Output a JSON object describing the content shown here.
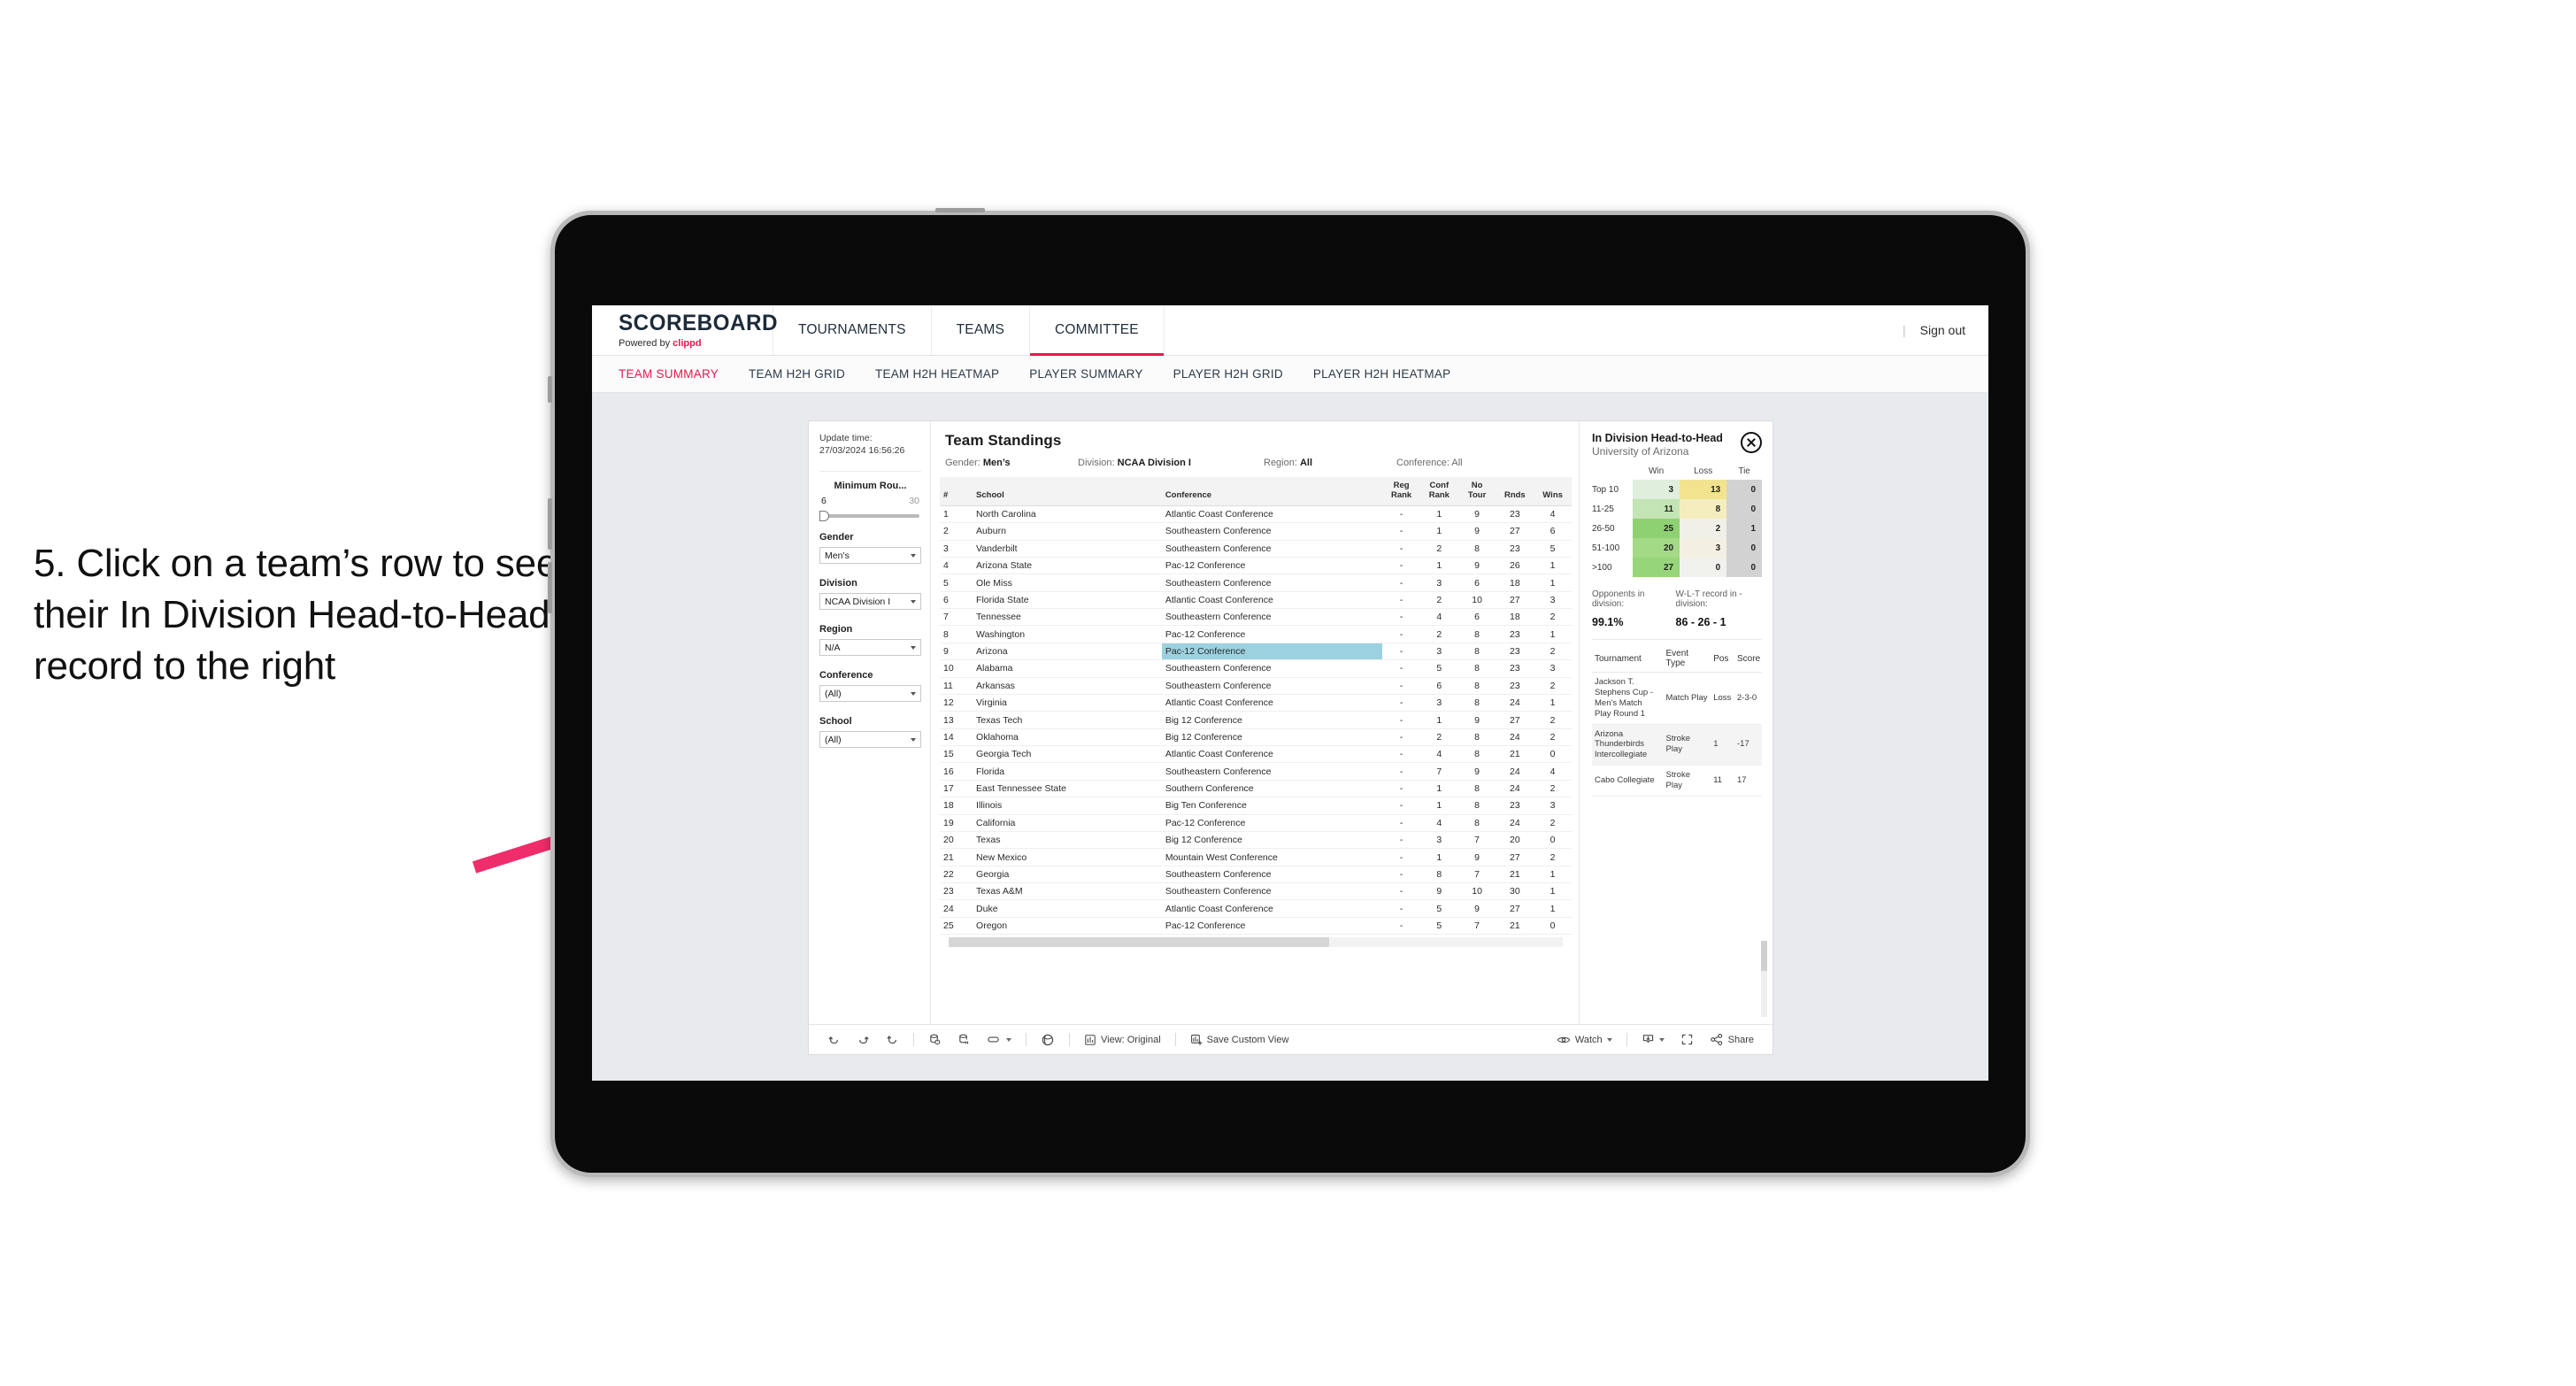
{
  "annotation": {
    "text": "5. Click on a team’s row to see their In Division Head-to-Head record to the right",
    "arrow_color": "#ef2d6b"
  },
  "brand": {
    "title": "SCOREBOARD",
    "powered_prefix": "Powered by ",
    "powered_name": "clippd",
    "accent": "#e8174c"
  },
  "topnav": {
    "items": [
      {
        "label": "TOURNAMENTS",
        "active": false
      },
      {
        "label": "TEAMS",
        "active": false
      },
      {
        "label": "COMMITTEE",
        "active": true
      }
    ],
    "separator": "|",
    "sign_out": "Sign out"
  },
  "subnav": {
    "tabs": [
      {
        "label": "TEAM SUMMARY",
        "active": true
      },
      {
        "label": "TEAM H2H GRID",
        "active": false
      },
      {
        "label": "TEAM H2H HEATMAP",
        "active": false
      },
      {
        "label": "PLAYER SUMMARY",
        "active": false
      },
      {
        "label": "PLAYER H2H GRID",
        "active": false
      },
      {
        "label": "PLAYER H2H HEATMAP",
        "active": false
      }
    ]
  },
  "filters": {
    "update_label": "Update time:",
    "update_value": "27/03/2024 16:56:26",
    "slider": {
      "label": "Minimum Rou...",
      "min": "6",
      "max": "30"
    },
    "gender": {
      "label": "Gender",
      "value": "Men’s"
    },
    "division": {
      "label": "Division",
      "value": "NCAA Division I"
    },
    "region": {
      "label": "Region",
      "value": "N/A"
    },
    "conference": {
      "label": "Conference",
      "value": "(All)"
    },
    "school": {
      "label": "School",
      "value": "(All)"
    }
  },
  "viz": {
    "title": "Team Standings",
    "meta": {
      "gender_label": "Gender: ",
      "gender_value": "Men’s",
      "division_label": "Division: ",
      "division_value": "NCAA Division I",
      "region_label": "Region: ",
      "region_value": "All",
      "conference_label": "Conference: ",
      "conference_value": "All"
    }
  },
  "standings": {
    "columns": [
      "#",
      "School",
      "Conference",
      "Reg Rank",
      "Conf Rank",
      "No Tour",
      "Rnds",
      "Wins"
    ],
    "columns_wrapped": [
      {
        "l1": "#",
        "l2": ""
      },
      {
        "l1": "School",
        "l2": ""
      },
      {
        "l1": "Conference",
        "l2": ""
      },
      {
        "l1": "Reg",
        "l2": "Rank"
      },
      {
        "l1": "Conf",
        "l2": "Rank"
      },
      {
        "l1": "No",
        "l2": "Tour"
      },
      {
        "l1": "Rnds",
        "l2": ""
      },
      {
        "l1": "Wins",
        "l2": ""
      }
    ],
    "selected_rank": 9,
    "selected_highlight_color": "#9cd2e0",
    "rows": [
      {
        "rank": "1",
        "school": "North Carolina",
        "conference": "Atlantic Coast Conference",
        "reg_rank": "-",
        "conf_rank": "1",
        "no_tour": "9",
        "rnds": "23",
        "wins": "4"
      },
      {
        "rank": "2",
        "school": "Auburn",
        "conference": "Southeastern Conference",
        "reg_rank": "-",
        "conf_rank": "1",
        "no_tour": "9",
        "rnds": "27",
        "wins": "6"
      },
      {
        "rank": "3",
        "school": "Vanderbilt",
        "conference": "Southeastern Conference",
        "reg_rank": "-",
        "conf_rank": "2",
        "no_tour": "8",
        "rnds": "23",
        "wins": "5"
      },
      {
        "rank": "4",
        "school": "Arizona State",
        "conference": "Pac-12 Conference",
        "reg_rank": "-",
        "conf_rank": "1",
        "no_tour": "9",
        "rnds": "26",
        "wins": "1"
      },
      {
        "rank": "5",
        "school": "Ole Miss",
        "conference": "Southeastern Conference",
        "reg_rank": "-",
        "conf_rank": "3",
        "no_tour": "6",
        "rnds": "18",
        "wins": "1"
      },
      {
        "rank": "6",
        "school": "Florida State",
        "conference": "Atlantic Coast Conference",
        "reg_rank": "-",
        "conf_rank": "2",
        "no_tour": "10",
        "rnds": "27",
        "wins": "3"
      },
      {
        "rank": "7",
        "school": "Tennessee",
        "conference": "Southeastern Conference",
        "reg_rank": "-",
        "conf_rank": "4",
        "no_tour": "6",
        "rnds": "18",
        "wins": "2"
      },
      {
        "rank": "8",
        "school": "Washington",
        "conference": "Pac-12 Conference",
        "reg_rank": "-",
        "conf_rank": "2",
        "no_tour": "8",
        "rnds": "23",
        "wins": "1"
      },
      {
        "rank": "9",
        "school": "Arizona",
        "conference": "Pac-12 Conference",
        "reg_rank": "-",
        "conf_rank": "3",
        "no_tour": "8",
        "rnds": "23",
        "wins": "2"
      },
      {
        "rank": "10",
        "school": "Alabama",
        "conference": "Southeastern Conference",
        "reg_rank": "-",
        "conf_rank": "5",
        "no_tour": "8",
        "rnds": "23",
        "wins": "3"
      },
      {
        "rank": "11",
        "school": "Arkansas",
        "conference": "Southeastern Conference",
        "reg_rank": "-",
        "conf_rank": "6",
        "no_tour": "8",
        "rnds": "23",
        "wins": "2"
      },
      {
        "rank": "12",
        "school": "Virginia",
        "conference": "Atlantic Coast Conference",
        "reg_rank": "-",
        "conf_rank": "3",
        "no_tour": "8",
        "rnds": "24",
        "wins": "1"
      },
      {
        "rank": "13",
        "school": "Texas Tech",
        "conference": "Big 12 Conference",
        "reg_rank": "-",
        "conf_rank": "1",
        "no_tour": "9",
        "rnds": "27",
        "wins": "2"
      },
      {
        "rank": "14",
        "school": "Oklahoma",
        "conference": "Big 12 Conference",
        "reg_rank": "-",
        "conf_rank": "2",
        "no_tour": "8",
        "rnds": "24",
        "wins": "2"
      },
      {
        "rank": "15",
        "school": "Georgia Tech",
        "conference": "Atlantic Coast Conference",
        "reg_rank": "-",
        "conf_rank": "4",
        "no_tour": "8",
        "rnds": "21",
        "wins": "0"
      },
      {
        "rank": "16",
        "school": "Florida",
        "conference": "Southeastern Conference",
        "reg_rank": "-",
        "conf_rank": "7",
        "no_tour": "9",
        "rnds": "24",
        "wins": "4"
      },
      {
        "rank": "17",
        "school": "East Tennessee State",
        "conference": "Southern Conference",
        "reg_rank": "-",
        "conf_rank": "1",
        "no_tour": "8",
        "rnds": "24",
        "wins": "2"
      },
      {
        "rank": "18",
        "school": "Illinois",
        "conference": "Big Ten Conference",
        "reg_rank": "-",
        "conf_rank": "1",
        "no_tour": "8",
        "rnds": "23",
        "wins": "3"
      },
      {
        "rank": "19",
        "school": "California",
        "conference": "Pac-12 Conference",
        "reg_rank": "-",
        "conf_rank": "4",
        "no_tour": "8",
        "rnds": "24",
        "wins": "2"
      },
      {
        "rank": "20",
        "school": "Texas",
        "conference": "Big 12 Conference",
        "reg_rank": "-",
        "conf_rank": "3",
        "no_tour": "7",
        "rnds": "20",
        "wins": "0"
      },
      {
        "rank": "21",
        "school": "New Mexico",
        "conference": "Mountain West Conference",
        "reg_rank": "-",
        "conf_rank": "1",
        "no_tour": "9",
        "rnds": "27",
        "wins": "2"
      },
      {
        "rank": "22",
        "school": "Georgia",
        "conference": "Southeastern Conference",
        "reg_rank": "-",
        "conf_rank": "8",
        "no_tour": "7",
        "rnds": "21",
        "wins": "1"
      },
      {
        "rank": "23",
        "school": "Texas A&M",
        "conference": "Southeastern Conference",
        "reg_rank": "-",
        "conf_rank": "9",
        "no_tour": "10",
        "rnds": "30",
        "wins": "1"
      },
      {
        "rank": "24",
        "school": "Duke",
        "conference": "Atlantic Coast Conference",
        "reg_rank": "-",
        "conf_rank": "5",
        "no_tour": "9",
        "rnds": "27",
        "wins": "1"
      },
      {
        "rank": "25",
        "school": "Oregon",
        "conference": "Pac-12 Conference",
        "reg_rank": "-",
        "conf_rank": "5",
        "no_tour": "7",
        "rnds": "21",
        "wins": "0"
      }
    ]
  },
  "h2h": {
    "title": "In Division Head-to-Head",
    "subtitle": "University of Arizona",
    "close_icon": "close-circle-icon",
    "chart_data": {
      "type": "heatmap",
      "title": "In Division Head-to-Head",
      "subtitle": "University of Arizona",
      "columns": [
        "Win",
        "Loss",
        "Tie"
      ],
      "rows": [
        "Top 10",
        "11-25",
        "26-50",
        "51-100",
        ">100"
      ],
      "values": [
        [
          3,
          13,
          0
        ],
        [
          11,
          8,
          0
        ],
        [
          25,
          2,
          1
        ],
        [
          20,
          3,
          0
        ],
        [
          27,
          0,
          0
        ]
      ],
      "cell_colors": [
        [
          "#dfeedd",
          "#f2e48f",
          "#d2d2d2"
        ],
        [
          "#c3e4b4",
          "#f5edbe",
          "#d2d2d2"
        ],
        [
          "#8ed172",
          "#f0efe8",
          "#d2d2d2"
        ],
        [
          "#a3da86",
          "#f3efe3",
          "#d2d2d2"
        ],
        [
          "#96d579",
          "#f1f1ee",
          "#d2d2d2"
        ]
      ]
    },
    "stats": [
      {
        "label": "Opponents in division:",
        "value": "99.1%"
      },
      {
        "label": "W-L-T record in -division:",
        "value": "86 - 26 - 1"
      }
    ],
    "events_columns": [
      "Tournament",
      "Event Type",
      "Pos",
      "Score"
    ],
    "events": [
      {
        "tournament": "Jackson T. Stephens Cup - Men’s Match Play Round 1",
        "event_type": "Match Play",
        "pos": "Loss",
        "score": "2-3-0"
      },
      {
        "tournament": "Arizona Thunderbirds Intercollegiate",
        "event_type": "Stroke Play",
        "pos": "1",
        "score": "-17"
      },
      {
        "tournament": "Cabo Collegiate",
        "event_type": "Stroke Play",
        "pos": "11",
        "score": "17"
      }
    ]
  },
  "toolbar": {
    "undo": "undo-icon",
    "redo": "redo-icon",
    "revert": "revert-icon",
    "refresh": "refresh-data-icon",
    "pause": "pause-updates-icon",
    "view_dropdown": "view-shape-icon",
    "alerts": "alerts-icon",
    "view_label": "View: Original",
    "save_label": "Save Custom View",
    "watch_label": "Watch",
    "download": "download-icon",
    "fullscreen": "fullscreen-icon",
    "share_label": "Share"
  }
}
